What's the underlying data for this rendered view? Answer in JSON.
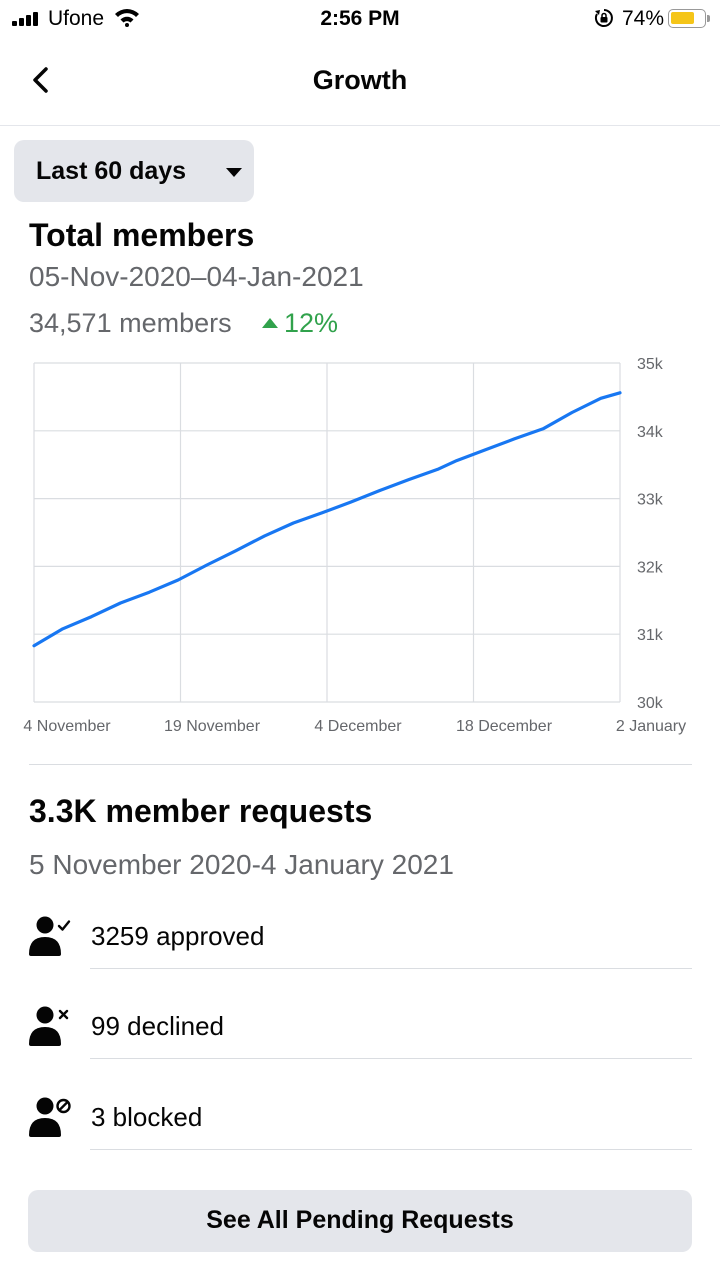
{
  "status_bar": {
    "carrier": "Ufone",
    "time": "2:56 PM",
    "battery_percent": "74%",
    "battery_level": 0.74,
    "battery_color": "#f5c518",
    "icons": [
      "signal-icon",
      "wifi-icon",
      "rotation-lock-icon",
      "battery-icon"
    ]
  },
  "header": {
    "title": "Growth",
    "back_icon": "back-arrow-icon"
  },
  "filter": {
    "selected": "Last 60 days",
    "icon": "caret-down-icon"
  },
  "total_members": {
    "title": "Total members",
    "date_range": "05-Nov-2020–04-Jan-2021",
    "count": "34,571 members",
    "change": "12%",
    "change_color": "#31a24c"
  },
  "chart_data": {
    "type": "line",
    "title": "",
    "xlabel": "",
    "ylabel": "",
    "x_tick_labels": [
      "4 November",
      "19 November",
      "4 December",
      "18 December",
      "2 January"
    ],
    "y_tick_labels": [
      "35k",
      "34k",
      "33k",
      "32k",
      "31k",
      "30k"
    ],
    "ylim": [
      30000,
      35000
    ],
    "xlim": [
      "2020-11-04",
      "2021-01-04"
    ],
    "grid": true,
    "line_color": "#1877f2",
    "series": [
      {
        "x": [
          "2020-11-04",
          "2020-11-07",
          "2020-11-10",
          "2020-11-13",
          "2020-11-16",
          "2020-11-19",
          "2020-11-22",
          "2020-11-25",
          "2020-11-28",
          "2020-12-01",
          "2020-12-04",
          "2020-12-07",
          "2020-12-10",
          "2020-12-13",
          "2020-12-16",
          "2020-12-18",
          "2020-12-21",
          "2020-12-24",
          "2020-12-27",
          "2020-12-30",
          "2021-01-02",
          "2021-01-04"
        ],
        "y": [
          30830,
          31080,
          31260,
          31460,
          31620,
          31800,
          32020,
          32230,
          32450,
          32640,
          32790,
          32950,
          33120,
          33280,
          33430,
          33560,
          33720,
          33880,
          34030,
          34270,
          34480,
          34560
        ]
      }
    ]
  },
  "member_requests": {
    "title": "3.3K member requests",
    "date_range": "5 November 2020-4 January 2021",
    "items": [
      {
        "label": "3259 approved",
        "icon": "person-check-icon"
      },
      {
        "label": "99 declined",
        "icon": "person-x-icon"
      },
      {
        "label": "3 blocked",
        "icon": "person-blocked-icon"
      }
    ]
  },
  "pending_button": {
    "label": "See All Pending Requests"
  }
}
